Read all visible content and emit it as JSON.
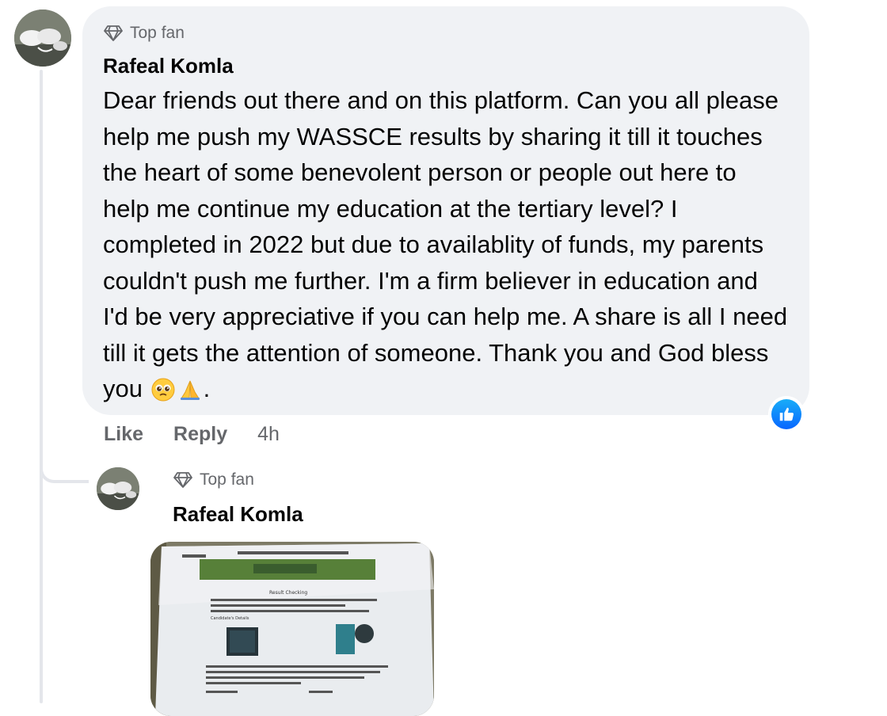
{
  "comment": {
    "badge_label": "Top fan",
    "badge_icon": "diamond-icon",
    "author": "Rafeal Komla",
    "text": "Dear friends out there and on this platform. Can you all please help me push my WASSCE results by sharing it till it touches the heart of some benevolent person or people out here to help me continue my education at the tertiary level? I completed in 2022 but due to availablity of funds, my parents couldn't push me further. I'm a firm believer in education and I'd be very appreciative if you can help me. A share is all I need till it gets the attention of someone. Thank you and God bless you",
    "text_end": ".",
    "emojis": [
      "pleading-face-emoji",
      "folded-hands-emoji"
    ],
    "reaction_icon": "like-reaction-icon",
    "actions": {
      "like_label": "Like",
      "reply_label": "Reply",
      "timestamp": "4h"
    }
  },
  "reply": {
    "badge_label": "Top fan",
    "badge_icon": "diamond-icon",
    "author": "Rafeal Komla",
    "image": {
      "title": "Result Checking",
      "subtitle": "Candidate's Details"
    }
  },
  "colors": {
    "bubble_bg": "#f0f2f5",
    "muted_text": "#65676b",
    "like_blue": "#0866ff",
    "thread_line": "#e4e6eb"
  }
}
